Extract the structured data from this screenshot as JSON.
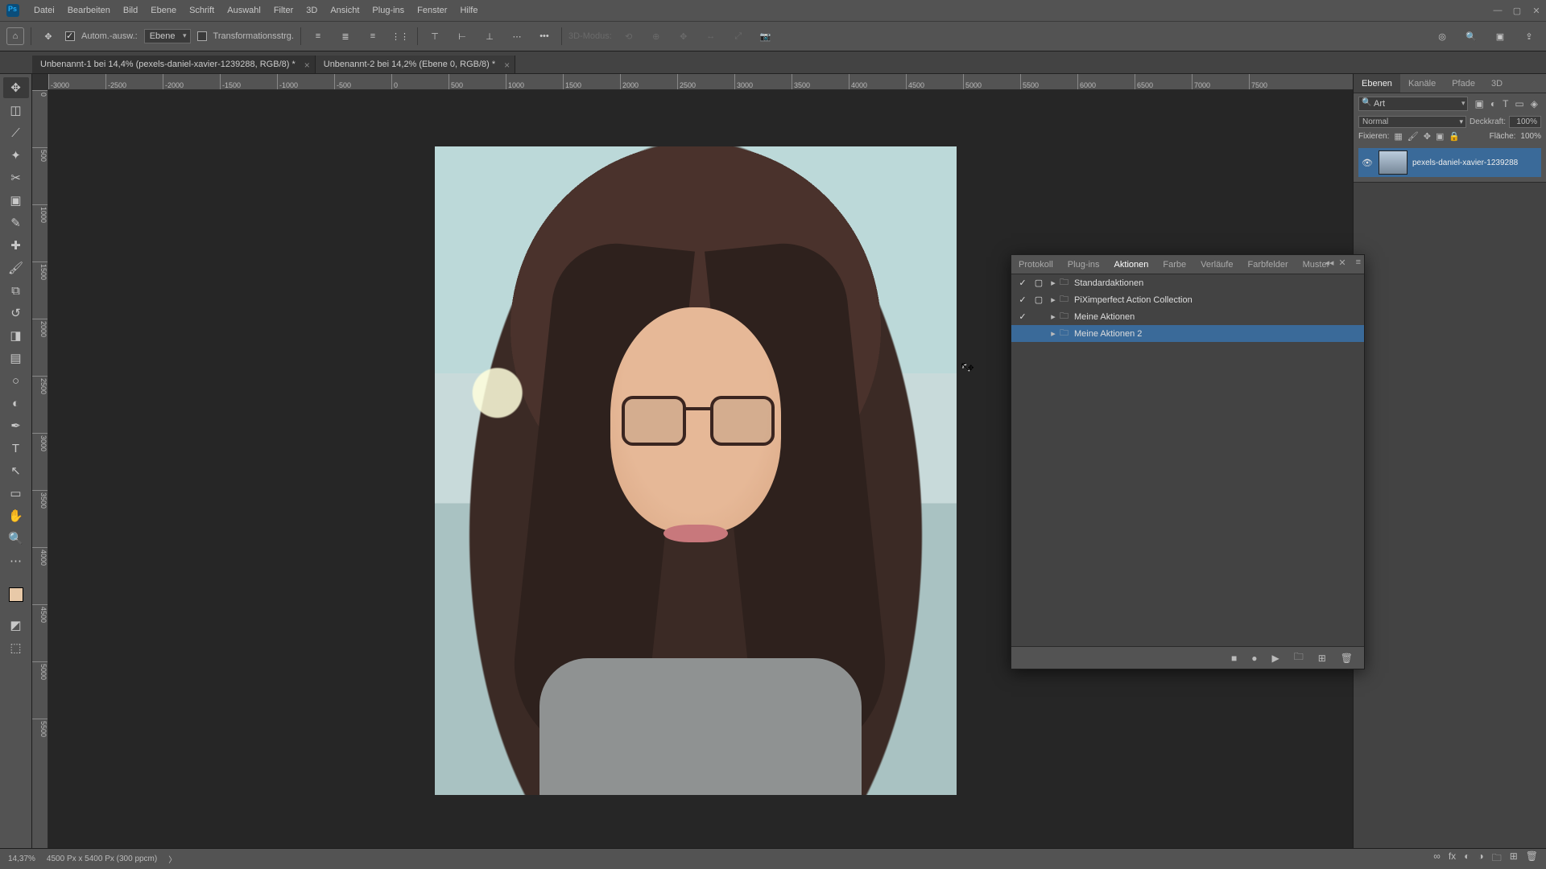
{
  "menubar": {
    "items": [
      "Datei",
      "Bearbeiten",
      "Bild",
      "Ebene",
      "Schrift",
      "Auswahl",
      "Filter",
      "3D",
      "Ansicht",
      "Plug-ins",
      "Fenster",
      "Hilfe"
    ]
  },
  "optbar": {
    "auto_select_label": "Autom.-ausw.:",
    "auto_select_value": "Ebene",
    "transform_label": "Transformationsstrg.",
    "mode_label": "3D-Modus:"
  },
  "tabs": [
    {
      "title": "Unbenannt-1 bei 14,4% (pexels-daniel-xavier-1239288, RGB/8) *",
      "active": true
    },
    {
      "title": "Unbenannt-2 bei 14,2% (Ebene 0, RGB/8) *",
      "active": false
    }
  ],
  "ruler_h": [
    "-3000",
    "-2500",
    "-2000",
    "-1500",
    "-1000",
    "-500",
    "0",
    "500",
    "1000",
    "1500",
    "2000",
    "2500",
    "3000",
    "3500",
    "4000",
    "4500",
    "5000",
    "5500",
    "6000",
    "6500",
    "7000",
    "7500"
  ],
  "ruler_v": [
    "0",
    "500",
    "1000",
    "1500",
    "2000",
    "2500",
    "3000",
    "3500",
    "4000",
    "4500",
    "5000",
    "5500"
  ],
  "tools": [
    {
      "name": "move-tool",
      "glyph": "✥",
      "active": true
    },
    {
      "name": "marquee-tool",
      "glyph": "◫"
    },
    {
      "name": "lasso-tool",
      "glyph": "⟋"
    },
    {
      "name": "magic-wand-tool",
      "glyph": "✦"
    },
    {
      "name": "crop-tool",
      "glyph": "✂"
    },
    {
      "name": "frame-tool",
      "glyph": "▣"
    },
    {
      "name": "eyedropper-tool",
      "glyph": "✎"
    },
    {
      "name": "healing-brush-tool",
      "glyph": "✚"
    },
    {
      "name": "brush-tool",
      "glyph": "🖌"
    },
    {
      "name": "clone-stamp-tool",
      "glyph": "⧉"
    },
    {
      "name": "history-brush-tool",
      "glyph": "↺"
    },
    {
      "name": "eraser-tool",
      "glyph": "◨"
    },
    {
      "name": "gradient-tool",
      "glyph": "▤"
    },
    {
      "name": "blur-tool",
      "glyph": "○"
    },
    {
      "name": "dodge-tool",
      "glyph": "◐"
    },
    {
      "name": "pen-tool",
      "glyph": "✒"
    },
    {
      "name": "type-tool",
      "glyph": "T"
    },
    {
      "name": "path-select-tool",
      "glyph": "↖"
    },
    {
      "name": "shape-tool",
      "glyph": "▭"
    },
    {
      "name": "hand-tool",
      "glyph": "✋"
    },
    {
      "name": "zoom-tool",
      "glyph": "🔍"
    },
    {
      "name": "more-tools",
      "glyph": "⋯"
    }
  ],
  "right_panel": {
    "tabs": [
      "Ebenen",
      "Kanäle",
      "Pfade",
      "3D"
    ],
    "active_tab": 0,
    "search_placeholder": "Art",
    "blend_label": "Normal",
    "opacity_label": "Deckkraft:",
    "opacity_value": "100%",
    "lock_label": "Fixieren:",
    "fill_label": "Fläche:",
    "fill_value": "100%",
    "layer_name": "pexels-daniel-xavier-1239288"
  },
  "actions_panel": {
    "tabs": [
      "Protokoll",
      "Plug-ins",
      "Aktionen",
      "Farbe",
      "Verläufe",
      "Farbfelder",
      "Muster"
    ],
    "active_tab": 2,
    "items": [
      {
        "check": true,
        "dialog": true,
        "name": "Standardaktionen",
        "selected": false
      },
      {
        "check": true,
        "dialog": true,
        "name": "PiXimperfect Action Collection",
        "selected": false
      },
      {
        "check": true,
        "dialog": false,
        "name": "Meine Aktionen",
        "selected": false
      },
      {
        "check": false,
        "dialog": false,
        "name": "Meine Aktionen 2",
        "selected": true
      }
    ]
  },
  "status": {
    "zoom": "14,37%",
    "dims": "4500 Px x 5400 Px (300 ppcm)"
  },
  "bottom_icons": {
    "chain": "∞",
    "fx": "fx",
    "mask": "◐",
    "adj": "◑",
    "group": "🗀",
    "new": "⊞",
    "trash": "🗑"
  }
}
